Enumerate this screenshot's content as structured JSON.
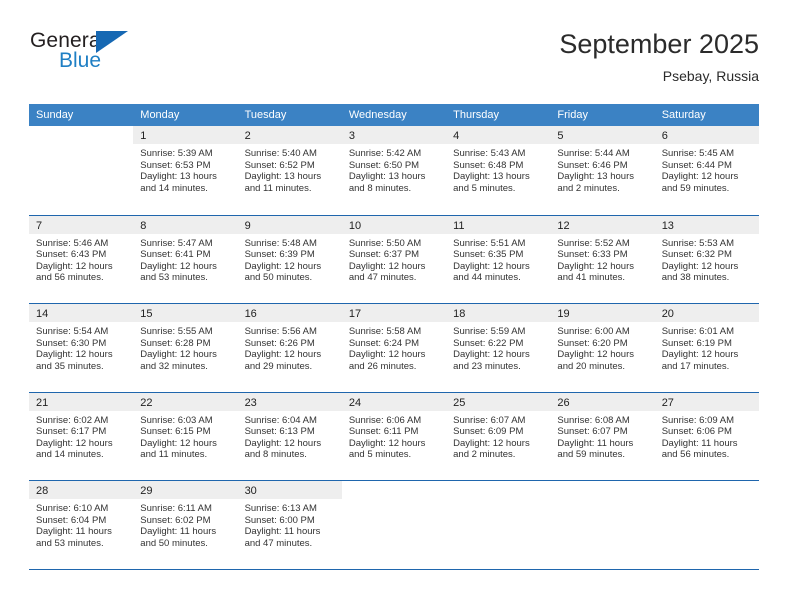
{
  "brand": {
    "name_part1": "General",
    "name_part2": "Blue",
    "logo_icon": "triangle-flag-icon"
  },
  "header": {
    "title": "September 2025",
    "location": "Psebay, Russia"
  },
  "calendar": {
    "weekdays": [
      "Sunday",
      "Monday",
      "Tuesday",
      "Wednesday",
      "Thursday",
      "Friday",
      "Saturday"
    ],
    "accent_color": "#3b82c4",
    "border_color": "#1f66ad",
    "daynum_bg": "#eeeeee",
    "weeks": [
      [
        {
          "day": "",
          "sunrise": "",
          "sunset": "",
          "daylight_line1": "",
          "daylight_line2": "",
          "empty": true
        },
        {
          "day": "1",
          "sunrise": "Sunrise: 5:39 AM",
          "sunset": "Sunset: 6:53 PM",
          "daylight_line1": "Daylight: 13 hours",
          "daylight_line2": "and 14 minutes.",
          "empty": false
        },
        {
          "day": "2",
          "sunrise": "Sunrise: 5:40 AM",
          "sunset": "Sunset: 6:52 PM",
          "daylight_line1": "Daylight: 13 hours",
          "daylight_line2": "and 11 minutes.",
          "empty": false
        },
        {
          "day": "3",
          "sunrise": "Sunrise: 5:42 AM",
          "sunset": "Sunset: 6:50 PM",
          "daylight_line1": "Daylight: 13 hours",
          "daylight_line2": "and 8 minutes.",
          "empty": false
        },
        {
          "day": "4",
          "sunrise": "Sunrise: 5:43 AM",
          "sunset": "Sunset: 6:48 PM",
          "daylight_line1": "Daylight: 13 hours",
          "daylight_line2": "and 5 minutes.",
          "empty": false
        },
        {
          "day": "5",
          "sunrise": "Sunrise: 5:44 AM",
          "sunset": "Sunset: 6:46 PM",
          "daylight_line1": "Daylight: 13 hours",
          "daylight_line2": "and 2 minutes.",
          "empty": false
        },
        {
          "day": "6",
          "sunrise": "Sunrise: 5:45 AM",
          "sunset": "Sunset: 6:44 PM",
          "daylight_line1": "Daylight: 12 hours",
          "daylight_line2": "and 59 minutes.",
          "empty": false
        }
      ],
      [
        {
          "day": "7",
          "sunrise": "Sunrise: 5:46 AM",
          "sunset": "Sunset: 6:43 PM",
          "daylight_line1": "Daylight: 12 hours",
          "daylight_line2": "and 56 minutes.",
          "empty": false
        },
        {
          "day": "8",
          "sunrise": "Sunrise: 5:47 AM",
          "sunset": "Sunset: 6:41 PM",
          "daylight_line1": "Daylight: 12 hours",
          "daylight_line2": "and 53 minutes.",
          "empty": false
        },
        {
          "day": "9",
          "sunrise": "Sunrise: 5:48 AM",
          "sunset": "Sunset: 6:39 PM",
          "daylight_line1": "Daylight: 12 hours",
          "daylight_line2": "and 50 minutes.",
          "empty": false
        },
        {
          "day": "10",
          "sunrise": "Sunrise: 5:50 AM",
          "sunset": "Sunset: 6:37 PM",
          "daylight_line1": "Daylight: 12 hours",
          "daylight_line2": "and 47 minutes.",
          "empty": false
        },
        {
          "day": "11",
          "sunrise": "Sunrise: 5:51 AM",
          "sunset": "Sunset: 6:35 PM",
          "daylight_line1": "Daylight: 12 hours",
          "daylight_line2": "and 44 minutes.",
          "empty": false
        },
        {
          "day": "12",
          "sunrise": "Sunrise: 5:52 AM",
          "sunset": "Sunset: 6:33 PM",
          "daylight_line1": "Daylight: 12 hours",
          "daylight_line2": "and 41 minutes.",
          "empty": false
        },
        {
          "day": "13",
          "sunrise": "Sunrise: 5:53 AM",
          "sunset": "Sunset: 6:32 PM",
          "daylight_line1": "Daylight: 12 hours",
          "daylight_line2": "and 38 minutes.",
          "empty": false
        }
      ],
      [
        {
          "day": "14",
          "sunrise": "Sunrise: 5:54 AM",
          "sunset": "Sunset: 6:30 PM",
          "daylight_line1": "Daylight: 12 hours",
          "daylight_line2": "and 35 minutes.",
          "empty": false
        },
        {
          "day": "15",
          "sunrise": "Sunrise: 5:55 AM",
          "sunset": "Sunset: 6:28 PM",
          "daylight_line1": "Daylight: 12 hours",
          "daylight_line2": "and 32 minutes.",
          "empty": false
        },
        {
          "day": "16",
          "sunrise": "Sunrise: 5:56 AM",
          "sunset": "Sunset: 6:26 PM",
          "daylight_line1": "Daylight: 12 hours",
          "daylight_line2": "and 29 minutes.",
          "empty": false
        },
        {
          "day": "17",
          "sunrise": "Sunrise: 5:58 AM",
          "sunset": "Sunset: 6:24 PM",
          "daylight_line1": "Daylight: 12 hours",
          "daylight_line2": "and 26 minutes.",
          "empty": false
        },
        {
          "day": "18",
          "sunrise": "Sunrise: 5:59 AM",
          "sunset": "Sunset: 6:22 PM",
          "daylight_line1": "Daylight: 12 hours",
          "daylight_line2": "and 23 minutes.",
          "empty": false
        },
        {
          "day": "19",
          "sunrise": "Sunrise: 6:00 AM",
          "sunset": "Sunset: 6:20 PM",
          "daylight_line1": "Daylight: 12 hours",
          "daylight_line2": "and 20 minutes.",
          "empty": false
        },
        {
          "day": "20",
          "sunrise": "Sunrise: 6:01 AM",
          "sunset": "Sunset: 6:19 PM",
          "daylight_line1": "Daylight: 12 hours",
          "daylight_line2": "and 17 minutes.",
          "empty": false
        }
      ],
      [
        {
          "day": "21",
          "sunrise": "Sunrise: 6:02 AM",
          "sunset": "Sunset: 6:17 PM",
          "daylight_line1": "Daylight: 12 hours",
          "daylight_line2": "and 14 minutes.",
          "empty": false
        },
        {
          "day": "22",
          "sunrise": "Sunrise: 6:03 AM",
          "sunset": "Sunset: 6:15 PM",
          "daylight_line1": "Daylight: 12 hours",
          "daylight_line2": "and 11 minutes.",
          "empty": false
        },
        {
          "day": "23",
          "sunrise": "Sunrise: 6:04 AM",
          "sunset": "Sunset: 6:13 PM",
          "daylight_line1": "Daylight: 12 hours",
          "daylight_line2": "and 8 minutes.",
          "empty": false
        },
        {
          "day": "24",
          "sunrise": "Sunrise: 6:06 AM",
          "sunset": "Sunset: 6:11 PM",
          "daylight_line1": "Daylight: 12 hours",
          "daylight_line2": "and 5 minutes.",
          "empty": false
        },
        {
          "day": "25",
          "sunrise": "Sunrise: 6:07 AM",
          "sunset": "Sunset: 6:09 PM",
          "daylight_line1": "Daylight: 12 hours",
          "daylight_line2": "and 2 minutes.",
          "empty": false
        },
        {
          "day": "26",
          "sunrise": "Sunrise: 6:08 AM",
          "sunset": "Sunset: 6:07 PM",
          "daylight_line1": "Daylight: 11 hours",
          "daylight_line2": "and 59 minutes.",
          "empty": false
        },
        {
          "day": "27",
          "sunrise": "Sunrise: 6:09 AM",
          "sunset": "Sunset: 6:06 PM",
          "daylight_line1": "Daylight: 11 hours",
          "daylight_line2": "and 56 minutes.",
          "empty": false
        }
      ],
      [
        {
          "day": "28",
          "sunrise": "Sunrise: 6:10 AM",
          "sunset": "Sunset: 6:04 PM",
          "daylight_line1": "Daylight: 11 hours",
          "daylight_line2": "and 53 minutes.",
          "empty": false
        },
        {
          "day": "29",
          "sunrise": "Sunrise: 6:11 AM",
          "sunset": "Sunset: 6:02 PM",
          "daylight_line1": "Daylight: 11 hours",
          "daylight_line2": "and 50 minutes.",
          "empty": false
        },
        {
          "day": "30",
          "sunrise": "Sunrise: 6:13 AM",
          "sunset": "Sunset: 6:00 PM",
          "daylight_line1": "Daylight: 11 hours",
          "daylight_line2": "and 47 minutes.",
          "empty": false
        },
        {
          "day": "",
          "sunrise": "",
          "sunset": "",
          "daylight_line1": "",
          "daylight_line2": "",
          "empty": true
        },
        {
          "day": "",
          "sunrise": "",
          "sunset": "",
          "daylight_line1": "",
          "daylight_line2": "",
          "empty": true
        },
        {
          "day": "",
          "sunrise": "",
          "sunset": "",
          "daylight_line1": "",
          "daylight_line2": "",
          "empty": true
        },
        {
          "day": "",
          "sunrise": "",
          "sunset": "",
          "daylight_line1": "",
          "daylight_line2": "",
          "empty": true
        }
      ]
    ]
  }
}
